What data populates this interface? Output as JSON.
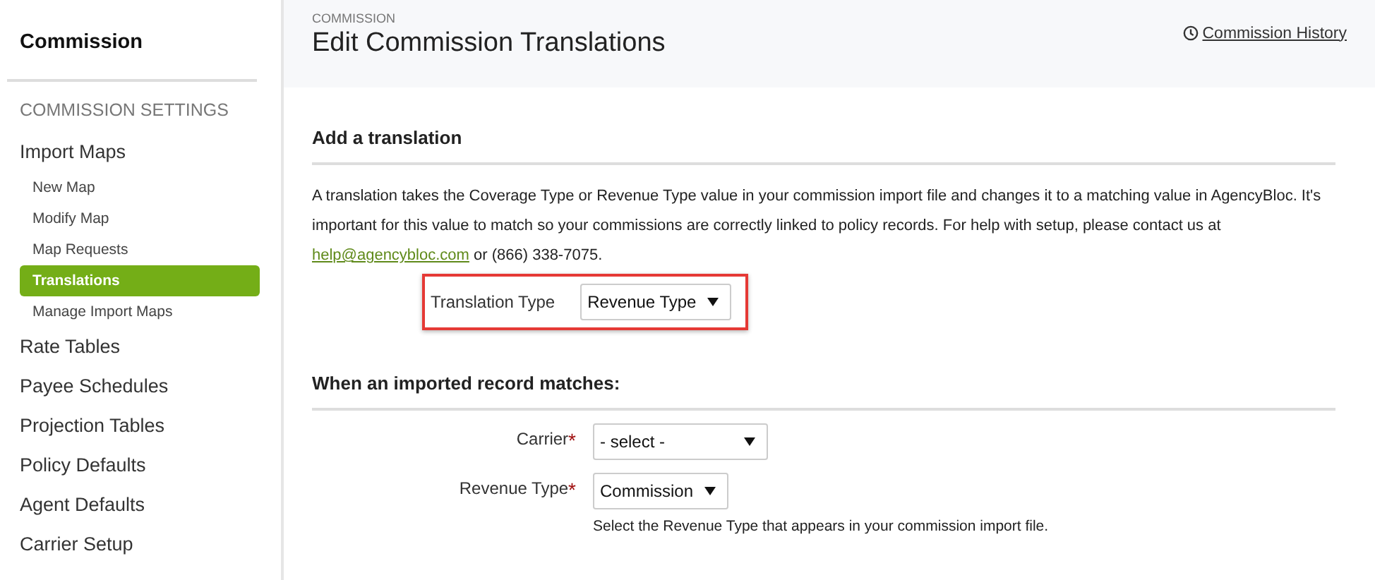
{
  "sidebar": {
    "title": "Commission",
    "section": "COMMISSION SETTINGS",
    "items": [
      {
        "label": "Import Maps",
        "selected": false,
        "children": [
          {
            "label": "New Map",
            "selected": false
          },
          {
            "label": "Modify Map",
            "selected": false
          },
          {
            "label": "Map Requests",
            "selected": false
          },
          {
            "label": "Translations",
            "selected": true
          },
          {
            "label": "Manage Import Maps",
            "selected": false
          }
        ]
      },
      {
        "label": "Rate Tables",
        "selected": false
      },
      {
        "label": "Payee Schedules",
        "selected": false
      },
      {
        "label": "Projection Tables",
        "selected": false
      },
      {
        "label": "Policy Defaults",
        "selected": false
      },
      {
        "label": "Agent Defaults",
        "selected": false
      },
      {
        "label": "Carrier Setup",
        "selected": false
      }
    ]
  },
  "header": {
    "breadcrumb": "COMMISSION",
    "title": "Edit Commission Translations",
    "history_link": "Commission History"
  },
  "add_section": {
    "title": "Add a translation",
    "description": "A translation takes the Coverage Type or Revenue Type value in your commission import file and changes it to a matching value in AgencyBloc. It's important for this value to match so your commissions are correctly linked to policy records. For help with setup, please contact us at",
    "email": "help@agencybloc.com",
    "phone_text": "or (866) 338-7075.",
    "field": {
      "label": "Translation Type",
      "value": "Revenue Type",
      "highlighted": true
    }
  },
  "match_section": {
    "title": "When an imported record matches:",
    "fields": [
      {
        "label": "Carrier",
        "required_mark": "*",
        "value": "- select -",
        "wide": true
      },
      {
        "label": "Revenue Type",
        "required_mark": "*",
        "value": "Commission",
        "wide": false,
        "help": "Select the Revenue Type that appears in your commission import file."
      }
    ]
  }
}
